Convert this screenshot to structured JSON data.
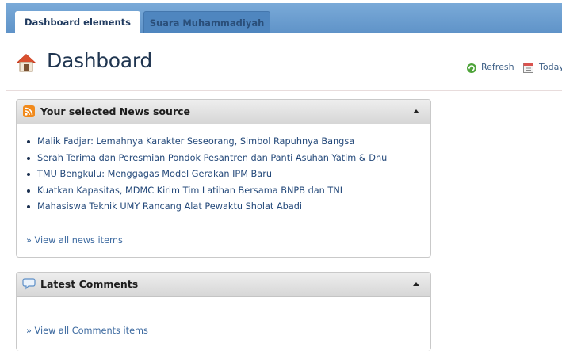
{
  "tabs": [
    {
      "label": "Dashboard elements",
      "active": true
    },
    {
      "label": "Suara Muhammadiyah",
      "active": false
    }
  ],
  "header": {
    "title": "Dashboard",
    "refresh_label": "Refresh",
    "today_label": "Today"
  },
  "news_widget": {
    "title": "Your selected News source",
    "items": [
      "Malik Fadjar: Lemahnya Karakter Seseorang, Simbol Rapuhnya Bangsa",
      "Serah Terima dan Peresmian Pondok Pesantren dan Panti Asuhan Yatim & Dhu",
      "TMU Bengkulu: Menggagas Model Gerakan IPM Baru",
      "Kuatkan Kapasitas, MDMC Kirim Tim Latihan Bersama BNPB dan TNI",
      "Mahasiswa Teknik UMY Rancang Alat Pewaktu Sholat Abadi"
    ],
    "view_all": "» View all news items"
  },
  "comments_widget": {
    "title": "Latest Comments",
    "view_all": "» View all Comments items"
  },
  "colors": {
    "tabbar": "#6b9ed0",
    "title": "#1f3550",
    "link": "#24497a"
  }
}
